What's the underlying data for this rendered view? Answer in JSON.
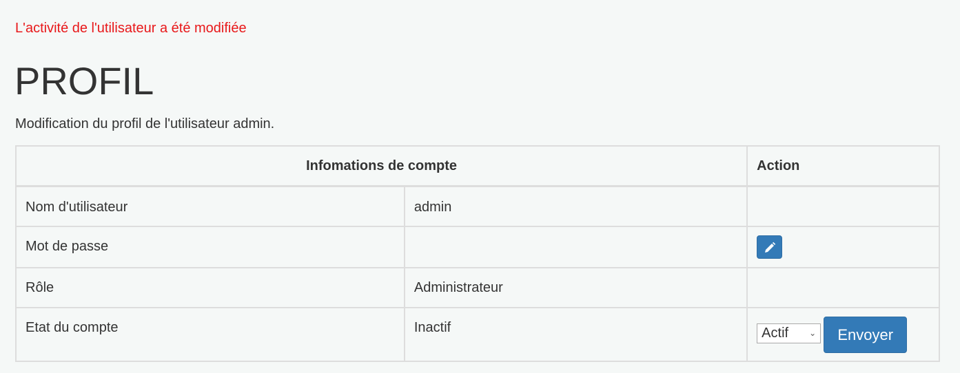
{
  "flash_message": "L'activité de l'utilisateur a été modifiée",
  "page_title": "PROFIL",
  "subtitle": "Modification du profil de l'utilisateur admin.",
  "table": {
    "headers": {
      "info": "Infomations de compte",
      "action": "Action"
    },
    "rows": [
      {
        "label": "Nom d'utilisateur",
        "value": "admin"
      },
      {
        "label": "Mot de passe",
        "value": ""
      },
      {
        "label": "Rôle",
        "value": "Administrateur"
      },
      {
        "label": "Etat du compte",
        "value": "Inactif"
      }
    ]
  },
  "actions": {
    "edit_password_icon": "pencil-icon",
    "status_select": {
      "selected": "Actif",
      "icon": "chevron-down-icon"
    },
    "send_label": "Envoyer"
  },
  "colors": {
    "flash": "#e8181a",
    "primary_button": "#337ab7",
    "background": "#f5f8f7",
    "border": "#dddddd"
  }
}
